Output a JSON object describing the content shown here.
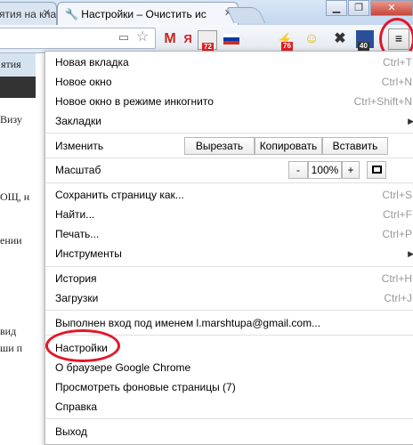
{
  "tabs": [
    {
      "title": "ятия на клавиатуре - мобилизован"
    },
    {
      "title": "Настройки – Очистить ис"
    }
  ],
  "toolbar_icons": [
    "page-icon",
    "star-icon",
    "gmail-icon",
    "yandex-icon",
    "mail-badge-icon",
    "flag-icon",
    "readability-icon",
    "smile-icon",
    "x-icon",
    "speed-badge-icon",
    "menu-icon"
  ],
  "toolbar_badges": {
    "mail": "72",
    "readability": "76",
    "speed": "40"
  },
  "page_fragments": [
    "ятия",
    "Визу",
    "ОЩ, н",
    "ении",
    "вид",
    "ши п"
  ],
  "menu": {
    "new_tab": {
      "label": "Новая вкладка",
      "shortcut": "Ctrl+T"
    },
    "new_window": {
      "label": "Новое окно",
      "shortcut": "Ctrl+N"
    },
    "incognito": {
      "label": "Новое окно в режиме инкогнито",
      "shortcut": "Ctrl+Shift+N"
    },
    "bookmarks": {
      "label": "Закладки"
    },
    "edit": {
      "label": "Изменить",
      "cut": "Вырезать",
      "copy": "Копировать",
      "paste": "Вставить"
    },
    "zoom": {
      "label": "Масштаб",
      "minus": "-",
      "value": "100%",
      "plus": "+"
    },
    "save_page": {
      "label": "Сохранить страницу как...",
      "shortcut": "Ctrl+S"
    },
    "find": {
      "label": "Найти...",
      "shortcut": "Ctrl+F"
    },
    "print": {
      "label": "Печать...",
      "shortcut": "Ctrl+P"
    },
    "tools": {
      "label": "Инструменты"
    },
    "history": {
      "label": "История",
      "shortcut": "Ctrl+H"
    },
    "downloads": {
      "label": "Загрузки",
      "shortcut": "Ctrl+J"
    },
    "signed_in": {
      "label": "Выполнен вход под именем l.marshtupa@gmail.com..."
    },
    "settings": {
      "label": "Настройки"
    },
    "about": {
      "label": "О браузере Google Chrome"
    },
    "background_pages": {
      "label": "Просмотреть фоновые страницы (7)"
    },
    "help": {
      "label": "Справка"
    },
    "exit": {
      "label": "Выход"
    }
  },
  "colors": {
    "highlight_circle": "#e4152a",
    "titlebar": "#c4d7ee"
  }
}
